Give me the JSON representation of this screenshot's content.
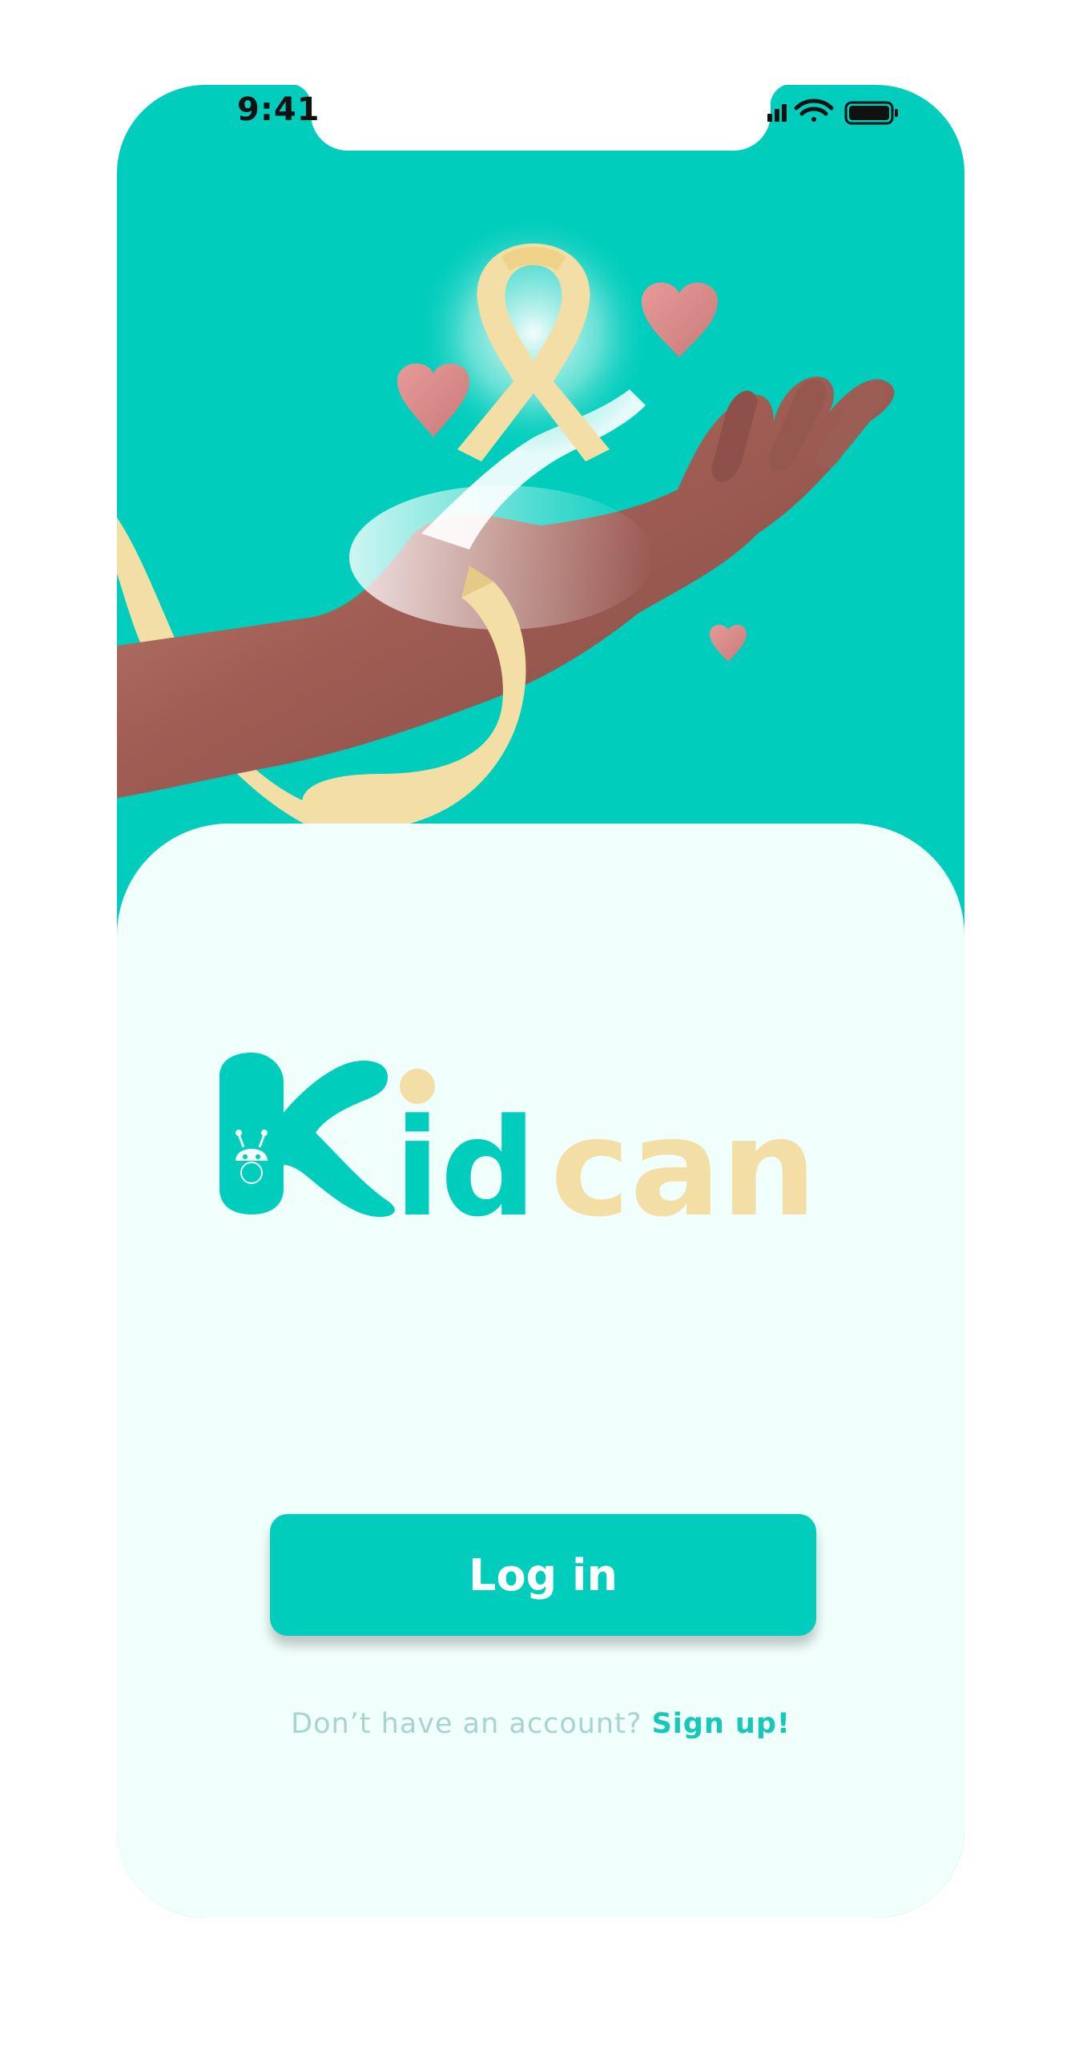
{
  "status_bar": {
    "time": "9:41",
    "icons": [
      "signal-icon",
      "wifi-icon",
      "battery-icon"
    ]
  },
  "hero": {
    "illustration": "hand-holding-ribbon-with-hearts"
  },
  "logo": {
    "part_primary": "Kid",
    "part_secondary": "can",
    "mascot_icon": "bug-face-icon"
  },
  "login": {
    "button_label": "Log in"
  },
  "signup": {
    "prompt": "Don’t have an account?",
    "link_label": "Sign up!"
  },
  "colors": {
    "brand_teal": "#00cdbc",
    "brand_cream": "#f3dea6",
    "card_background": "#f0fefc",
    "prompt_text": "#a7d4d1",
    "heart_pink": "#e08f8f",
    "skin": "#a5665c"
  }
}
